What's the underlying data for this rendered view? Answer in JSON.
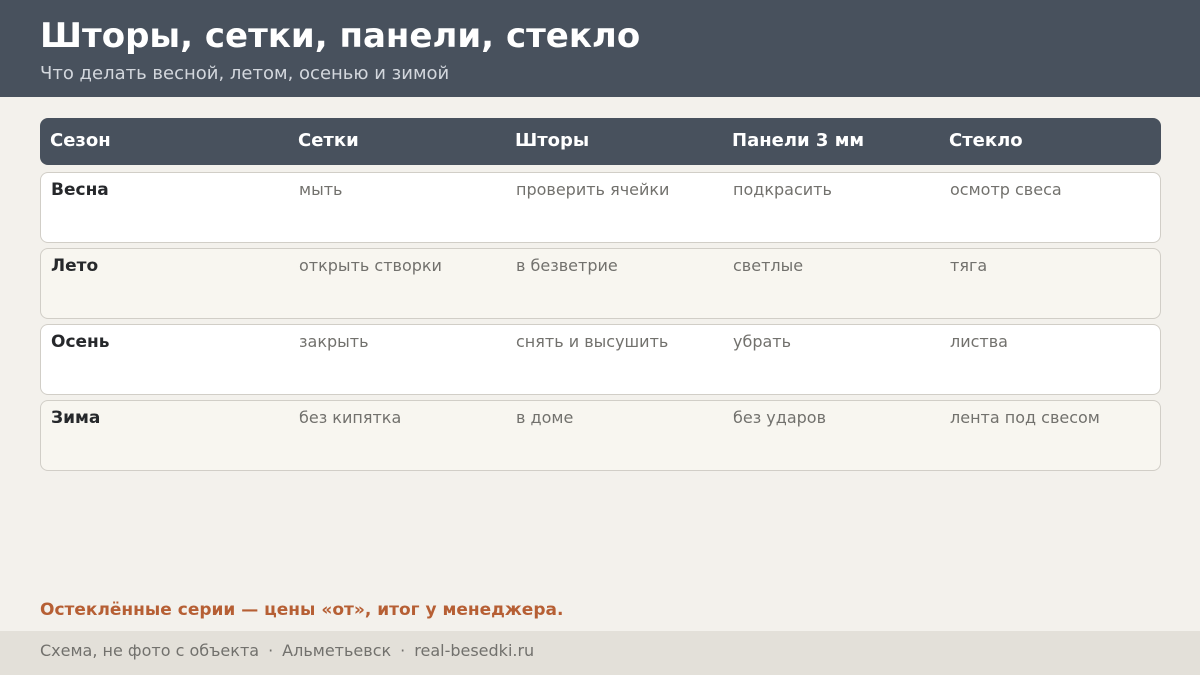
{
  "header": {
    "title": "Шторы, сетки, панели, стекло",
    "subtitle": "Что делать весной, летом, осенью и зимой"
  },
  "table": {
    "columns": [
      "Сезон",
      "Сетки",
      "Шторы",
      "Панели 3 мм",
      "Стекло"
    ],
    "rows": [
      [
        "Весна",
        "мыть",
        "проверить ячейки",
        "подкрасить",
        "осмотр свеса"
      ],
      [
        "Лето",
        "открыть створки",
        "в безветрие",
        "светлые",
        "тяга"
      ],
      [
        "Осень",
        "закрыть",
        "снять и высушить",
        "убрать",
        "листва"
      ],
      [
        "Зима",
        "без кипятка",
        "в доме",
        "без ударов",
        "лента под свесом"
      ]
    ]
  },
  "note": "Остеклённые серии — цены «от», итог у менеджера.",
  "footer": {
    "items": [
      "Схема, не фото с объекта",
      "Альметьевск",
      "real-besedki.ru"
    ],
    "separator": "·"
  },
  "colors": {
    "header_bg": "#48515d",
    "page_bg": "#f3f1ec",
    "accent": "#b65f34",
    "footer_bg": "#e3e0d9"
  }
}
